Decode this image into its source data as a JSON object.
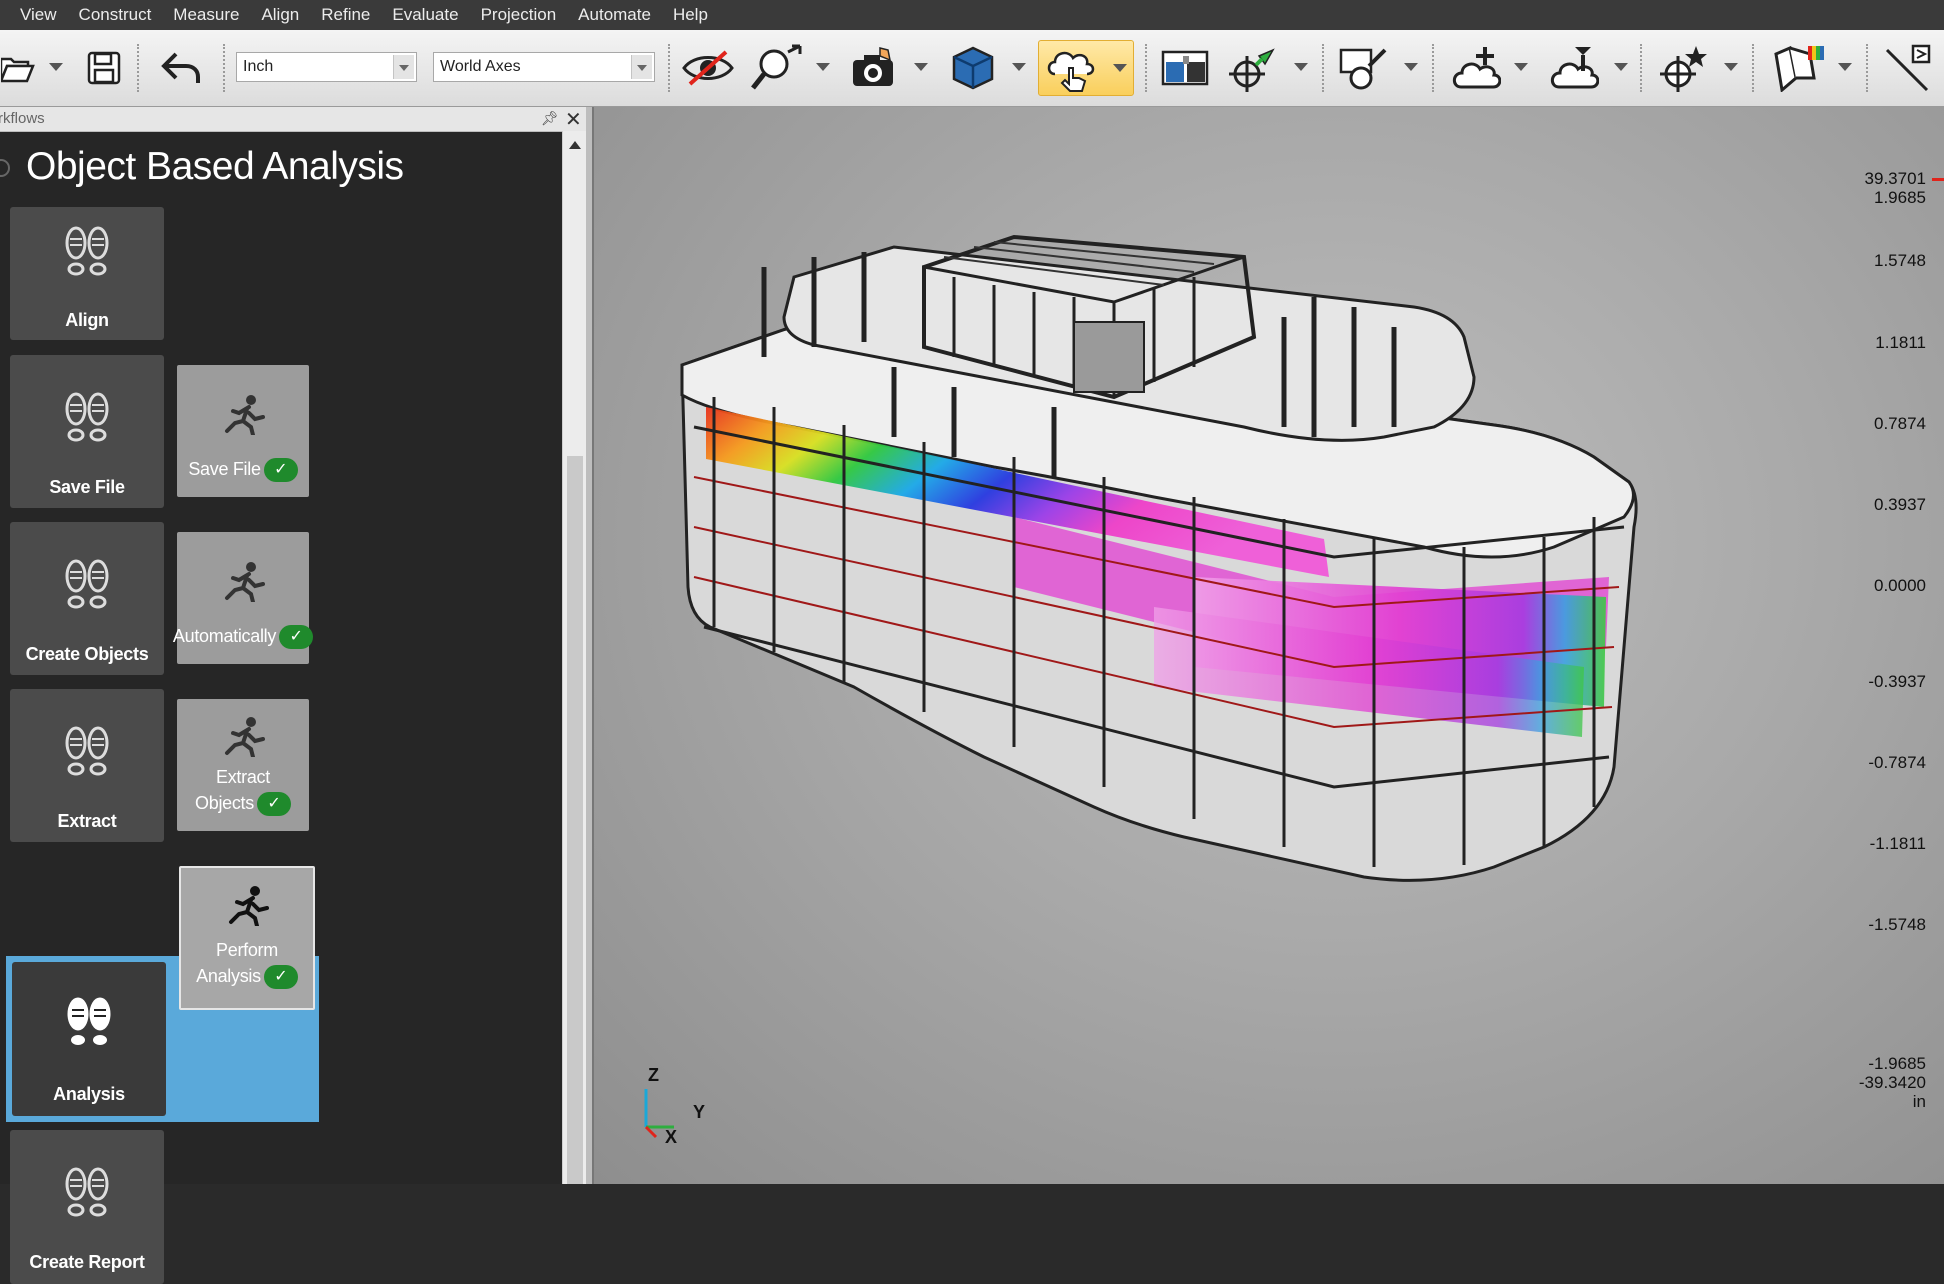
{
  "menu": [
    "View",
    "Construct",
    "Measure",
    "Align",
    "Refine",
    "Evaluate",
    "Projection",
    "Automate",
    "Help"
  ],
  "toolbar": {
    "units_combo": "Inch",
    "axes_combo": "World Axes"
  },
  "panel": {
    "title": "rkflows",
    "workflow_title": "Object Based Analysis",
    "steps": [
      {
        "label": "Align"
      },
      {
        "label": "Save File"
      },
      {
        "label": "Create Objects"
      },
      {
        "label": "Extract"
      },
      {
        "label": "Analysis"
      },
      {
        "label": "Create Report"
      }
    ],
    "tasks": [
      {
        "line1": "Save File",
        "line2": ""
      },
      {
        "line1": "",
        "line2": "Automatically"
      },
      {
        "line1": "Extract",
        "line2": "Objects"
      },
      {
        "line1": "Perform",
        "line2": "Analysis"
      }
    ],
    "check_glyph": "✓"
  },
  "viewport": {
    "scale_top": [
      "39.3701",
      "1.9685"
    ],
    "scale_values": [
      "1.5748",
      "1.1811",
      "0.7874",
      "0.3937",
      "0.0000",
      "-0.3937",
      "-0.7874",
      "-1.1811",
      "-1.5748"
    ],
    "scale_bottom": [
      "-1.9685",
      "-39.3420",
      "in"
    ],
    "axis": {
      "z": "Z",
      "y": "Y",
      "x": "X"
    }
  },
  "colors": {
    "highlight": "#5aa9da",
    "check": "#1f8a2c",
    "active_tool": "#f9cf5c"
  }
}
